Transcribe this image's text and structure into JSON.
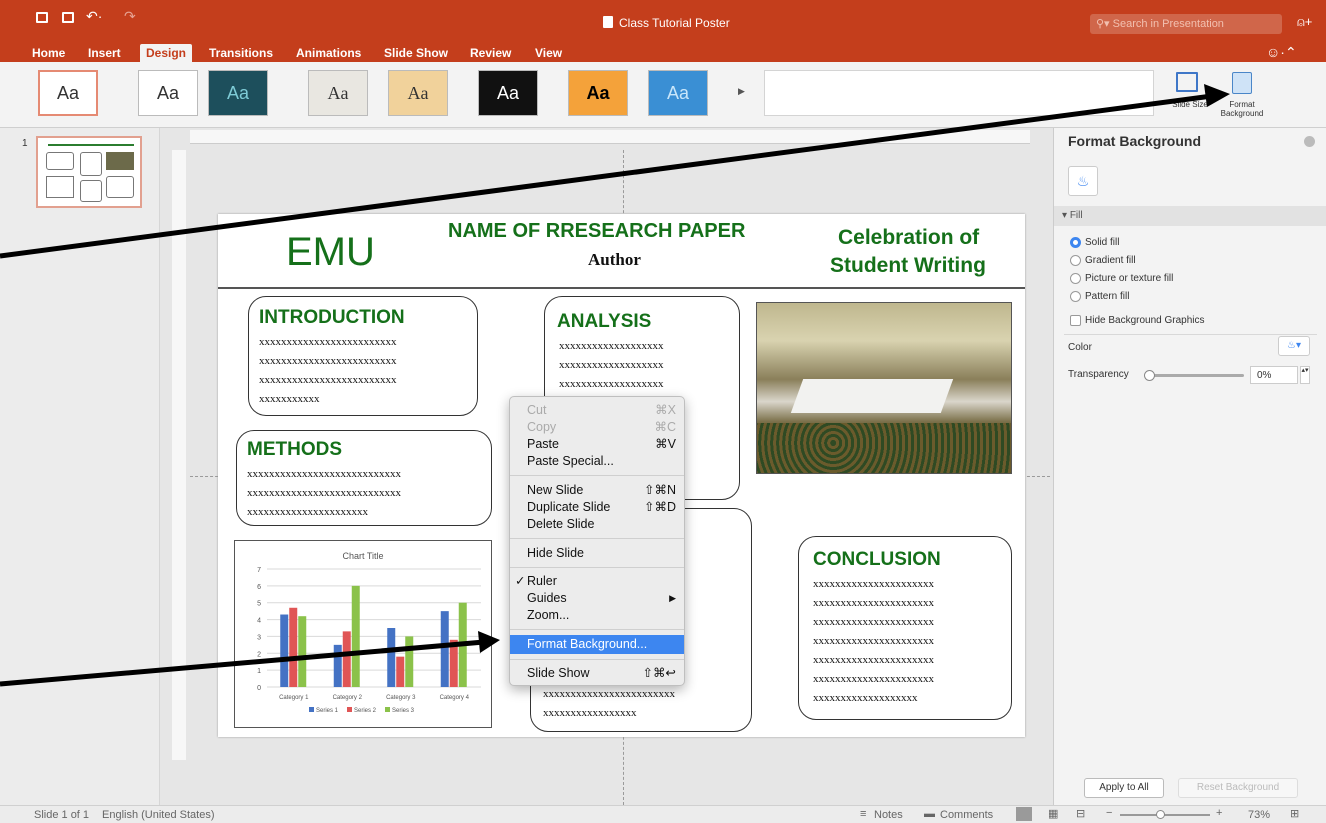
{
  "window": {
    "title": "Class Tutorial Poster",
    "search_placeholder": "Search in Presentation"
  },
  "ribbon_tabs": [
    "Home",
    "Insert",
    "Design",
    "Transitions",
    "Animations",
    "Slide Show",
    "Review",
    "View"
  ],
  "ribbon": {
    "theme_label": "Aa",
    "slide_size_label": "Slide Size",
    "format_background_label": "Format Background"
  },
  "thumbnails": {
    "number": "1"
  },
  "slide": {
    "emu": "EMU",
    "paper_title": "NAME OF RRESEARCH PAPER",
    "author": "Author",
    "celebration_line1": "Celebration of",
    "celebration_line2": "Student Writing",
    "introduction": {
      "title": "INTRODUCTION",
      "text": "xxxxxxxxxxxxxxxxxxxxxxxxx\nxxxxxxxxxxxxxxxxxxxxxxxxx\nxxxxxxxxxxxxxxxxxxxxxxxxx\nxxxxxxxxxxx"
    },
    "methods": {
      "title": "METHODS",
      "text": "xxxxxxxxxxxxxxxxxxxxxxxxxxxx\nxxxxxxxxxxxxxxxxxxxxxxxxxxxx\nxxxxxxxxxxxxxxxxxxxxxx"
    },
    "analysis": {
      "title": "ANALYSIS",
      "text": "xxxxxxxxxxxxxxxxxxx\nxxxxxxxxxxxxxxxxxxx\nxxxxxxxxxxxxxxxxxxx\nxxxxxxxxxxxxxxxxxxx\nxxxxxxxxxxxxxxxxxxx\nxxxxxxxxxxxxxxxxxxx\nxxxxxxxxxxxxxxxxxxx"
    },
    "results": {
      "text_a": "xxxxxxxxxxxxxxxxxxxxx",
      "text_b": "xxxxxxxxxxxxxxxxxxxxx",
      "text_c": "xxxxxxxxxxxxxxxxxxxxxxxx\nxxxxxxxxxxxxxxxxx"
    },
    "conclusion": {
      "title": "CONCLUSION",
      "text": "xxxxxxxxxxxxxxxxxxxxxx\nxxxxxxxxxxxxxxxxxxxxxx\nxxxxxxxxxxxxxxxxxxxxxx\nxxxxxxxxxxxxxxxxxxxxxx\nxxxxxxxxxxxxxxxxxxxxxx\nxxxxxxxxxxxxxxxxxxxxxx\nxxxxxxxxxxxxxxxxxxx"
    }
  },
  "chart_data": {
    "type": "bar",
    "title": "Chart Title",
    "categories": [
      "Category 1",
      "Category 2",
      "Category 3",
      "Category 4"
    ],
    "series": [
      {
        "name": "Series 1",
        "values": [
          4.3,
          2.5,
          3.5,
          4.5
        ],
        "color": "#4472c4"
      },
      {
        "name": "Series 2",
        "values": [
          4.7,
          3.3,
          1.8,
          2.8
        ],
        "color": "#e05555"
      },
      {
        "name": "Series 3",
        "values": [
          4.2,
          6.0,
          3.0,
          5.0
        ],
        "color": "#8bc24a"
      }
    ],
    "ylim": [
      0,
      7
    ],
    "yticks": [
      "0",
      "1",
      "2",
      "3",
      "4",
      "5",
      "6",
      "7"
    ],
    "grid": true,
    "legend": "bottom"
  },
  "context_menu": {
    "cut": "Cut",
    "cut_sc": "⌘X",
    "copy": "Copy",
    "copy_sc": "⌘C",
    "paste": "Paste",
    "paste_sc": "⌘V",
    "paste_special": "Paste Special...",
    "new_slide": "New Slide",
    "new_slide_sc": "⇧⌘N",
    "duplicate_slide": "Duplicate Slide",
    "duplicate_slide_sc": "⇧⌘D",
    "delete_slide": "Delete Slide",
    "hide_slide": "Hide Slide",
    "ruler": "Ruler",
    "check": "✓",
    "guides": "Guides",
    "guides_arrow": "▶",
    "zoom": "Zoom...",
    "format_background": "Format Background...",
    "slide_show": "Slide Show",
    "slide_show_sc": "⇧⌘↩"
  },
  "format_pane": {
    "title": "Format Background",
    "section": "Fill",
    "options": [
      "Solid fill",
      "Gradient fill",
      "Picture or texture fill",
      "Pattern fill"
    ],
    "hide_graphics": "Hide Background Graphics",
    "color_label": "Color",
    "transparency_label": "Transparency",
    "transparency_value": "0%",
    "apply_all": "Apply to All",
    "reset": "Reset Background"
  },
  "status": {
    "slide": "Slide 1 of 1",
    "language": "English (United States)",
    "notes": "Notes",
    "comments": "Comments",
    "zoom": "73%"
  }
}
